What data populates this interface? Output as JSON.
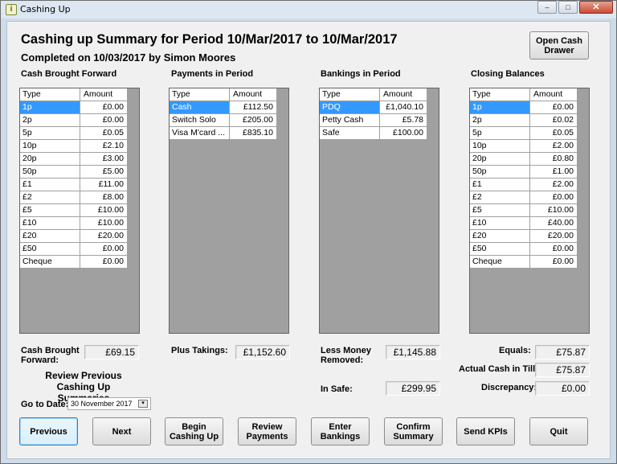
{
  "window": {
    "title": "Cashing Up",
    "app_icon": "i",
    "minimize": "–",
    "maximize": "□",
    "close": "✕"
  },
  "header": {
    "title": "Cashing up Summary for Period 10/Mar/2017 to 10/Mar/2017",
    "subtitle": "Completed on 10/03/2017 by Simon Moores",
    "open_cash_drawer": "Open Cash\nDrawer"
  },
  "grid_headers": {
    "type": "Type",
    "amount": "Amount"
  },
  "cash_brought_forward": {
    "label": "Cash Brought Forward",
    "rows": [
      {
        "type": "1p",
        "amount": "£0.00"
      },
      {
        "type": "2p",
        "amount": "£0.00"
      },
      {
        "type": "5p",
        "amount": "£0.05"
      },
      {
        "type": "10p",
        "amount": "£2.10"
      },
      {
        "type": "20p",
        "amount": "£3.00"
      },
      {
        "type": "50p",
        "amount": "£5.00"
      },
      {
        "type": "£1",
        "amount": "£11.00"
      },
      {
        "type": "£2",
        "amount": "£8.00"
      },
      {
        "type": "£5",
        "amount": "£10.00"
      },
      {
        "type": "£10",
        "amount": "£10.00"
      },
      {
        "type": "£20",
        "amount": "£20.00"
      },
      {
        "type": "£50",
        "amount": "£0.00"
      },
      {
        "type": "Cheque",
        "amount": "£0.00"
      }
    ],
    "total_label": "Cash Brought\nForward:",
    "total": "£69.15"
  },
  "payments_in_period": {
    "label": "Payments in Period",
    "rows": [
      {
        "type": "Cash",
        "amount": "£112.50"
      },
      {
        "type": "Switch Solo",
        "amount": "£205.00"
      },
      {
        "type": "Visa M'card ...",
        "amount": "£835.10"
      }
    ],
    "total_label": "Plus Takings:",
    "total": "£1,152.60"
  },
  "bankings_in_period": {
    "label": "Bankings in Period",
    "rows": [
      {
        "type": "PDQ",
        "amount": "£1,040.10"
      },
      {
        "type": "Petty Cash",
        "amount": "£5.78"
      },
      {
        "type": "Safe",
        "amount": "£100.00"
      }
    ],
    "total_label": "Less Money\nRemoved:",
    "total": "£1,145.88",
    "safe_label": "In Safe:",
    "safe": "£299.95"
  },
  "closing_balances": {
    "label": "Closing Balances",
    "rows": [
      {
        "type": "1p",
        "amount": "£0.00"
      },
      {
        "type": "2p",
        "amount": "£0.02"
      },
      {
        "type": "5p",
        "amount": "£0.05"
      },
      {
        "type": "10p",
        "amount": "£2.00"
      },
      {
        "type": "20p",
        "amount": "£0.80"
      },
      {
        "type": "50p",
        "amount": "£1.00"
      },
      {
        "type": "£1",
        "amount": "£2.00"
      },
      {
        "type": "£2",
        "amount": "£0.00"
      },
      {
        "type": "£5",
        "amount": "£10.00"
      },
      {
        "type": "£10",
        "amount": "£40.00"
      },
      {
        "type": "£20",
        "amount": "£20.00"
      },
      {
        "type": "£50",
        "amount": "£0.00"
      },
      {
        "type": "Cheque",
        "amount": "£0.00"
      }
    ],
    "equals_label": "Equals:",
    "equals": "£75.87",
    "actual_label": "Actual Cash in Till:",
    "actual": "£75.87",
    "discrepancy_label": "Discrepancy:",
    "discrepancy": "£0.00"
  },
  "review": {
    "label": "Review Previous\nCashing Up Summaries",
    "goto_label": "Go to Date:",
    "date_value": "30 November 2017"
  },
  "buttons": {
    "previous": "Previous",
    "next": "Next",
    "begin": "Begin\nCashing Up",
    "review_payments": "Review\nPayments",
    "enter_bankings": "Enter\nBankings",
    "confirm_summary": "Confirm\nSummary",
    "send_kpis": "Send KPIs",
    "quit": "Quit"
  },
  "colors": {
    "selection": "#3399ff",
    "grid_background": "#a0a0a0",
    "window_frame": "#cfdbe9"
  }
}
